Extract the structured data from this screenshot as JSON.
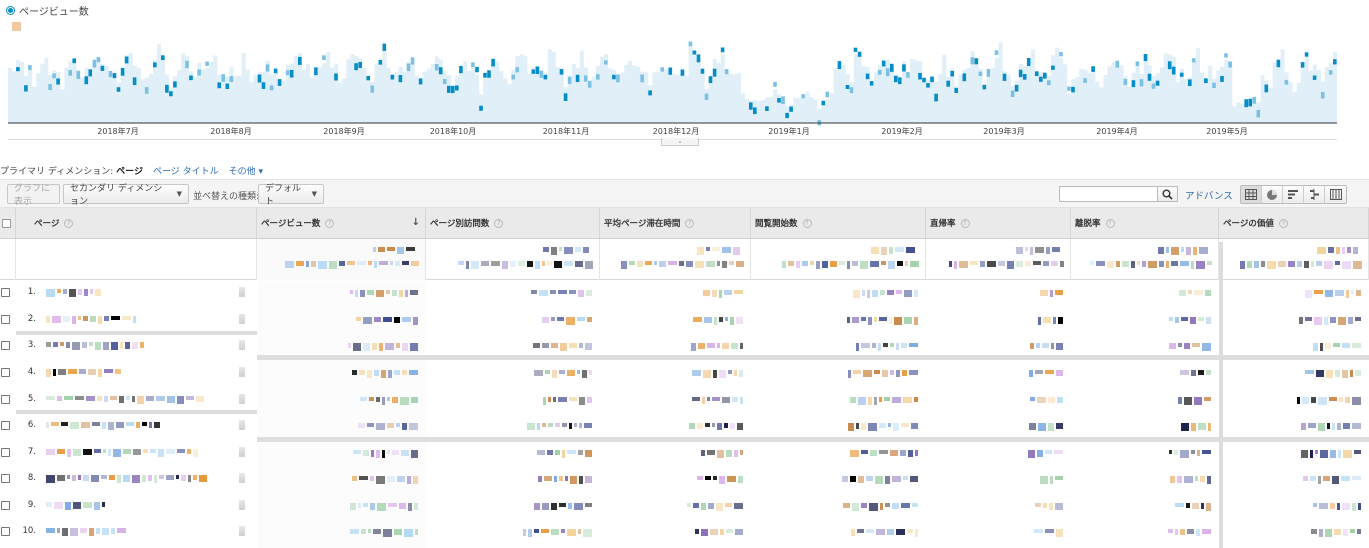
{
  "chart": {
    "legend": "ページビュー数",
    "series_color": "#058dc7",
    "fill_color": "#e1f0f8",
    "axis_months": [
      "2018年7月",
      "2018年8月",
      "2018年9月",
      "2018年10月",
      "2018年11月",
      "2018年12月",
      "2019年1月",
      "2019年2月",
      "2019年3月",
      "2019年4月",
      "2019年5月"
    ]
  },
  "primary_dimension": {
    "label": "プライマリ ディメンション:",
    "active": "ページ",
    "options": [
      "ページ タイトル",
      "その他 ▾"
    ]
  },
  "toolbar": {
    "graph_button": "グラフに表示",
    "secondary_dimension": "セカンダリ ディメンション",
    "sort_type_label": "並べ替えの種類:",
    "sort_type_value": "デフォルト",
    "search_placeholder": "",
    "advanced_link": "アドバンス"
  },
  "table": {
    "columns": [
      {
        "label": "ページ"
      },
      {
        "label": "ページビュー数",
        "sorted": true
      },
      {
        "label": "ページ別訪問数"
      },
      {
        "label": "平均ページ滞在時間"
      },
      {
        "label": "閲覧開始数"
      },
      {
        "label": "直帰率"
      },
      {
        "label": "離脱率"
      },
      {
        "label": "ページの価値"
      }
    ],
    "rows": [
      {
        "num": "1."
      },
      {
        "num": "2."
      },
      {
        "num": "3."
      },
      {
        "num": "4."
      },
      {
        "num": "5."
      },
      {
        "num": "6."
      },
      {
        "num": "7."
      },
      {
        "num": "8."
      },
      {
        "num": "9."
      },
      {
        "num": "10."
      }
    ]
  }
}
